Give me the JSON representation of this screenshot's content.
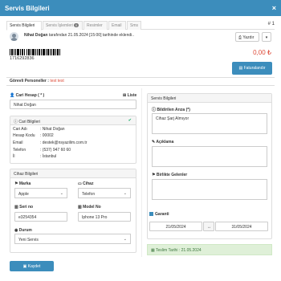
{
  "window": {
    "title": "Servis Bilgileri",
    "close_glyph": "×"
  },
  "tabs": [
    {
      "label": "Servis Bilgileri",
      "active": true
    },
    {
      "label": "Servis İşlemleri",
      "badge": "0"
    },
    {
      "label": "Resimler"
    },
    {
      "label": "Email"
    },
    {
      "label": "Sms"
    }
  ],
  "tab_number": "# 1",
  "created": {
    "user": "Nihat Doğan",
    "text": " tarafından 21.05.2024 [15:00] tarihinde eklendi.."
  },
  "print": {
    "label": "Yazdır",
    "icon": "printer-icon"
  },
  "barcode_number": "1716292836",
  "amount": "0,00 ₺",
  "invoice_button": "Faturalandır",
  "personnel": {
    "label": "Görevli Personeller : ",
    "value": "test test"
  },
  "customer": {
    "label": "Cari Hesap ( * )",
    "list_label": "Liste",
    "value": "Nihat Doğan",
    "panel_title": "Cari Bilgileri",
    "rows": [
      {
        "key": "Cari Adı",
        "value": ": Nihat Doğan"
      },
      {
        "key": "Hesap Kodu",
        "value": ": 00002"
      },
      {
        "key": "Email",
        "value": ": destek@nsyazilim.com.tr"
      },
      {
        "key": "Telefon",
        "value": ": (537) 947 60 60"
      },
      {
        "key": "İl",
        "value": ": İstanbul"
      }
    ]
  },
  "device": {
    "panel_title": "Cihaz Bilgileri",
    "brand_label": "Marka",
    "brand_value": "Apple",
    "device_label": "Cihaz",
    "device_value": "Telefon",
    "serial_label": "Seri no",
    "serial_value": "e3254354",
    "model_label": "Model No",
    "model_value": "Iphone 13 Pro",
    "status_label": "Durum",
    "status_value": "Yeni Servis"
  },
  "service": {
    "panel_title": "Servis Bilgileri",
    "fault_label": "Bildirilen Arıza (*)",
    "fault_value": "Cihaz Şarj Almıyor",
    "note_label": "Açıklama",
    "items_label": "Birlikte Gelenler",
    "warranty_label": "Garanti",
    "warranty_start": "21/05/2024",
    "warranty_sep": "↔",
    "warranty_end": "31/05/2024",
    "delivery": "Teslim Tarihi : 21.05.2024"
  },
  "save_button": "Kaydet",
  "colors": {
    "primary": "#3c8dbc",
    "danger": "#dd4b39",
    "success": "#00a65a"
  }
}
